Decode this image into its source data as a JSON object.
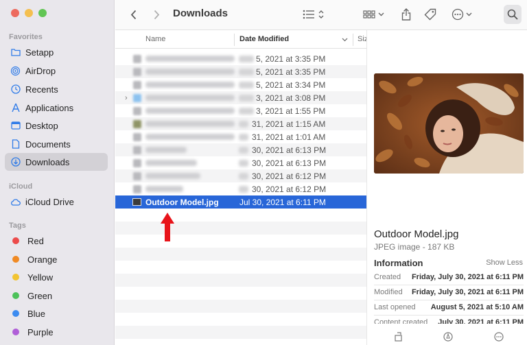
{
  "window": {
    "title": "Downloads",
    "traffic_colors": [
      "#ed6a5e",
      "#f4bf4f",
      "#61c554"
    ]
  },
  "sidebar": {
    "favorites_label": "Favorites",
    "favorites": [
      {
        "label": "Setapp",
        "icon": "folder-icon"
      },
      {
        "label": "AirDrop",
        "icon": "airdrop-icon"
      },
      {
        "label": "Recents",
        "icon": "clock-icon"
      },
      {
        "label": "Applications",
        "icon": "applications-icon"
      },
      {
        "label": "Desktop",
        "icon": "desktop-icon"
      },
      {
        "label": "Documents",
        "icon": "document-icon"
      },
      {
        "label": "Downloads",
        "icon": "download-icon",
        "active": true
      }
    ],
    "icloud_label": "iCloud",
    "icloud": [
      {
        "label": "iCloud Drive",
        "icon": "cloud-icon"
      }
    ],
    "tags_label": "Tags",
    "tags": [
      {
        "label": "Red",
        "color": "#ec4b4b"
      },
      {
        "label": "Orange",
        "color": "#f08a24"
      },
      {
        "label": "Yellow",
        "color": "#f2c432"
      },
      {
        "label": "Green",
        "color": "#4dc25a"
      },
      {
        "label": "Blue",
        "color": "#3d8cf0"
      },
      {
        "label": "Purple",
        "color": "#b05fd8"
      }
    ]
  },
  "list": {
    "col_name": "Name",
    "col_date": "Date Modified",
    "col_size": "Siz",
    "rows": [
      {
        "date": "5, 2021 at 3:35 PM"
      },
      {
        "date": "5, 2021 at 3:35 PM"
      },
      {
        "date": "5, 2021 at 3:34 PM"
      },
      {
        "date": "3, 2021 at 3:08 PM",
        "folder": true
      },
      {
        "date": "3, 2021 at 1:55 PM"
      },
      {
        "date": "31, 2021 at 1:15 AM"
      },
      {
        "date": "31, 2021 at 1:01 AM"
      },
      {
        "date": "30, 2021 at 6:13 PM"
      },
      {
        "date": "30, 2021 at 6:13 PM"
      },
      {
        "date": "30, 2021 at 6:12 PM"
      },
      {
        "date": "30, 2021 at 6:12 PM"
      }
    ],
    "selected": {
      "name": "Outdoor Model.jpg",
      "date": "Jul 30, 2021 at 6:11 PM"
    },
    "accent": "#2866d8"
  },
  "preview": {
    "name": "Outdoor Model.jpg",
    "kind": "JPEG image - 187 KB",
    "info_label": "Information",
    "show_less": "Show Less",
    "rows": [
      {
        "k": "Created",
        "v": "Friday, July 30, 2021 at 6:11 PM"
      },
      {
        "k": "Modified",
        "v": "Friday, July 30, 2021 at 6:11 PM"
      },
      {
        "k": "Last opened",
        "v": "August 5, 2021 at 5:10 AM"
      },
      {
        "k": "Content created",
        "v": "July 30, 2021 at 6:11 PM"
      }
    ]
  }
}
